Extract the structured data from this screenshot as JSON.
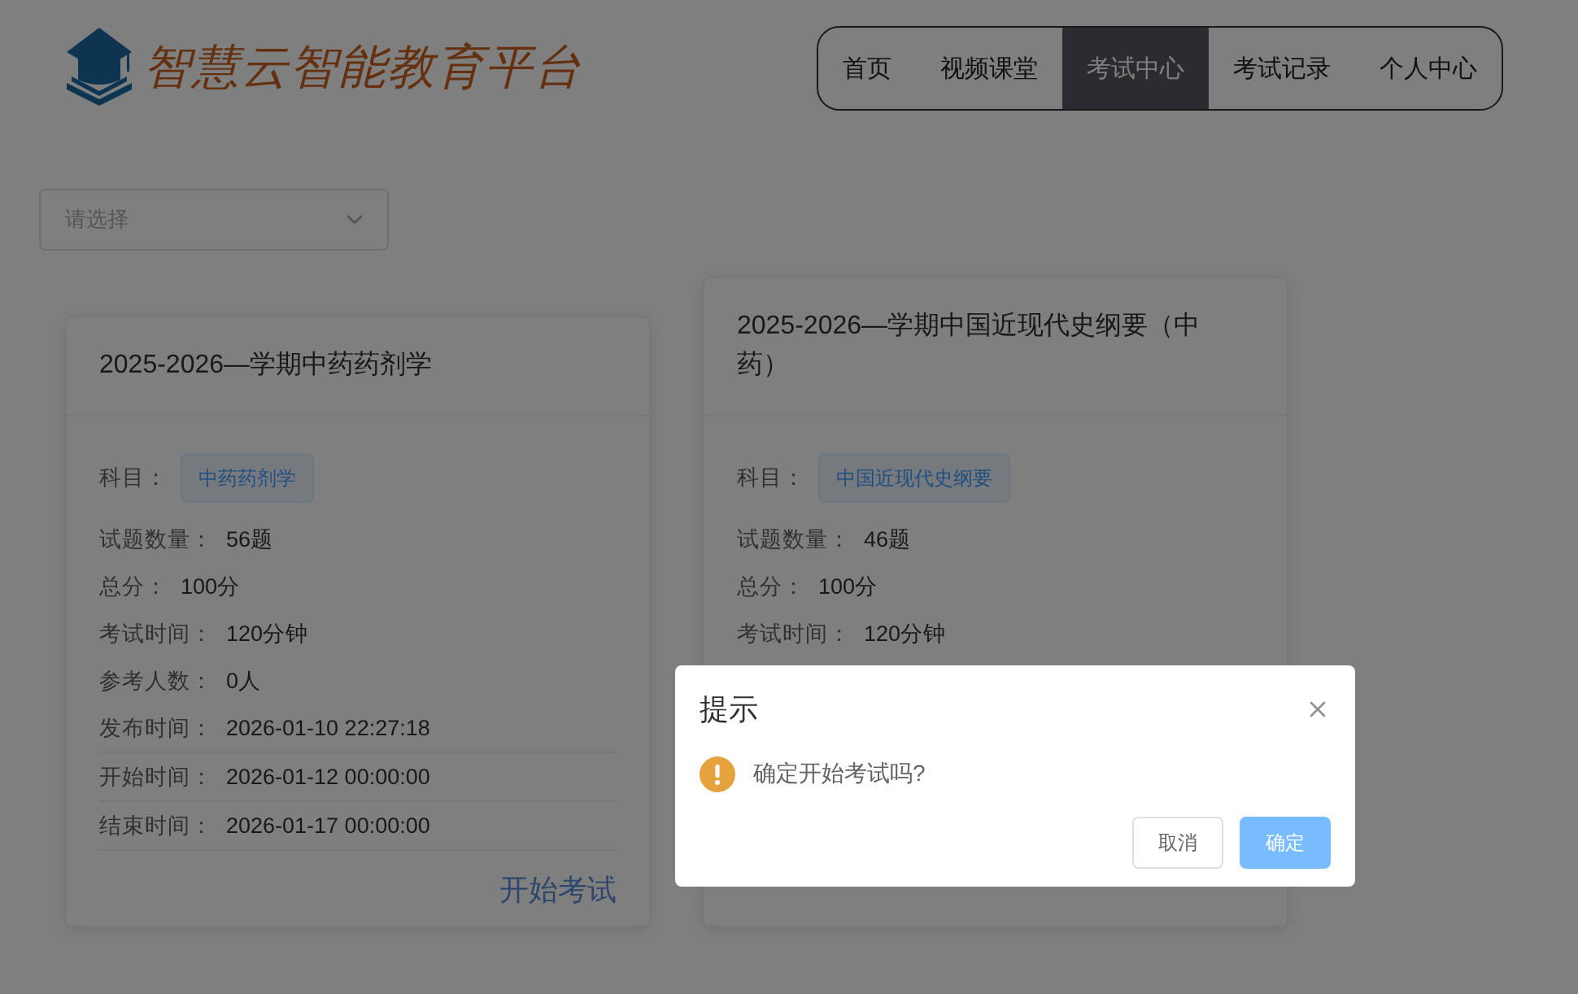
{
  "logo": {
    "text": "智慧云智能教育平台"
  },
  "nav": [
    {
      "label": "首页",
      "selected": false
    },
    {
      "label": "视频课堂",
      "selected": false
    },
    {
      "label": "考试中心",
      "selected": true
    },
    {
      "label": "考试记录",
      "selected": false
    },
    {
      "label": "个人中心",
      "selected": false
    }
  ],
  "filter": {
    "placeholder": "请选择"
  },
  "exams": [
    {
      "title": "2025-2026—学期中药药剂学",
      "subject_label": "科目：",
      "subject": "中药药剂学",
      "rows": [
        {
          "label": "试题数量：",
          "value": "56题",
          "kind": "plain"
        },
        {
          "label": "总分：",
          "value": "100分",
          "kind": "plain"
        },
        {
          "label": "考试时间：",
          "value": "120分钟",
          "kind": "plain"
        },
        {
          "label": "参考人数：",
          "value": "0人",
          "kind": "plain"
        },
        {
          "label": "发布时间：",
          "value": "2026-01-10 22:27:18",
          "kind": "ruled"
        },
        {
          "label": "开始时间：",
          "value": "2026-01-12 00:00:00",
          "kind": "ruled"
        },
        {
          "label": "结束时间：",
          "value": "2026-01-17 00:00:00",
          "kind": "ruled"
        }
      ],
      "action": "开始考试"
    },
    {
      "title": "2025-2026—学期中国近现代史纲要（中药）",
      "subject_label": "科目：",
      "subject": "中国近现代史纲要",
      "rows": [
        {
          "label": "试题数量：",
          "value": "46题",
          "kind": "plain"
        },
        {
          "label": "总分：",
          "value": "100分",
          "kind": "plain"
        },
        {
          "label": "考试时间：",
          "value": "120分钟",
          "kind": "plain"
        }
      ]
    }
  ],
  "dialog": {
    "title": "提示",
    "message": "确定开始考试吗?",
    "buttons": [
      {
        "label": "取消",
        "kind": "secondary"
      },
      {
        "label": "确定",
        "kind": "primary"
      }
    ]
  }
}
